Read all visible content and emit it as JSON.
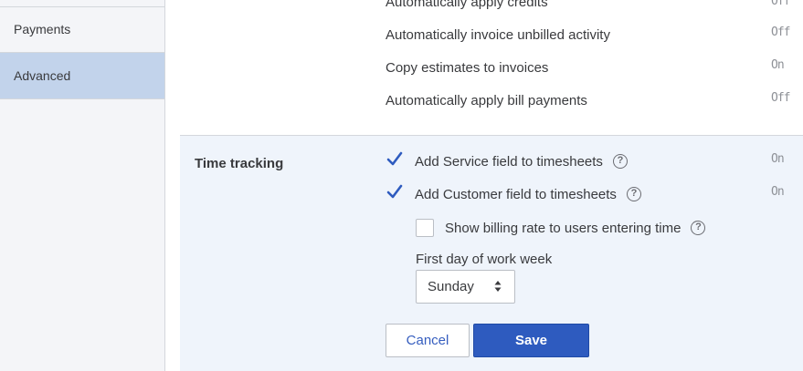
{
  "sidebar": {
    "items": [
      {
        "label": "Payments",
        "active": false
      },
      {
        "label": "Advanced",
        "active": true
      }
    ]
  },
  "invoice_settings": [
    {
      "label": "Automatically apply credits",
      "status": "Off"
    },
    {
      "label": "Automatically invoice unbilled activity",
      "status": "Off"
    },
    {
      "label": "Copy estimates to invoices",
      "status": "On"
    },
    {
      "label": "Automatically apply bill payments",
      "status": "Off"
    }
  ],
  "time_tracking": {
    "title": "Time tracking",
    "options": [
      {
        "label": "Add Service field to timesheets",
        "checked": true,
        "status": "On",
        "help": "?"
      },
      {
        "label": "Add Customer field to timesheets",
        "checked": true,
        "status": "On",
        "help": "?"
      },
      {
        "label": "Show billing rate to users entering time",
        "checked": false,
        "help": "?"
      }
    ],
    "work_week_label": "First day of work week",
    "work_week_value": "Sunday",
    "cancel_label": "Cancel",
    "save_label": "Save"
  },
  "colors": {
    "accent": "#2e5bbf",
    "active_sidebar": "#c2d3eb",
    "section_bg": "#eff4fb",
    "checkmark": "#2e5bbf"
  },
  "icons": {
    "check": "checkmark-icon",
    "help": "help-circle-icon",
    "select_arrows": "sort-arrows-icon"
  }
}
